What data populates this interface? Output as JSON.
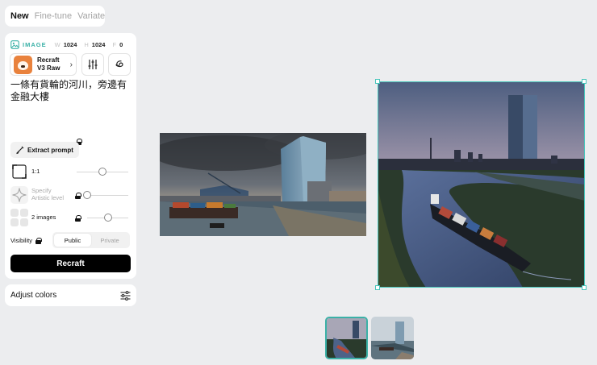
{
  "tabs": [
    {
      "label": "New",
      "active": true
    },
    {
      "label": "Fine-tune",
      "active": false
    },
    {
      "label": "Variate",
      "active": false
    }
  ],
  "settings": {
    "type_label": "IMAGE",
    "width_label": "W",
    "width_value": "1024",
    "height_label": "H",
    "height_value": "1024",
    "frames_label": "F",
    "frames_value": "0"
  },
  "model": {
    "name_line1": "Recraft",
    "name_line2": "V3 Raw",
    "icon": "red-panda-avatar"
  },
  "prompt": "一條有貨輪的河川，旁邊有金融大樓",
  "extract_prompt_label": "Extract prompt",
  "options": {
    "aspect_ratio": {
      "label": "1:1",
      "slider": 0.5
    },
    "artistic_level": {
      "label_line1": "Specify",
      "label_line2": "Artistic level",
      "slider": 0.0
    },
    "image_count": {
      "label": "2 images",
      "slider": 0.5
    }
  },
  "visibility": {
    "label": "Visibility",
    "public": "Public",
    "private": "Private",
    "selected": "Public"
  },
  "generate_button": "Recraft",
  "adjust_colors_label": "Adjust colors",
  "colors": {
    "accent": "#3bb1a7",
    "selection": "#48c5bb",
    "primary_button": "#000000",
    "background": "#ecedef"
  },
  "thumbnails": [
    {
      "name": "thumbnail-square-image",
      "selected": true
    },
    {
      "name": "thumbnail-wide-image",
      "selected": false
    }
  ]
}
